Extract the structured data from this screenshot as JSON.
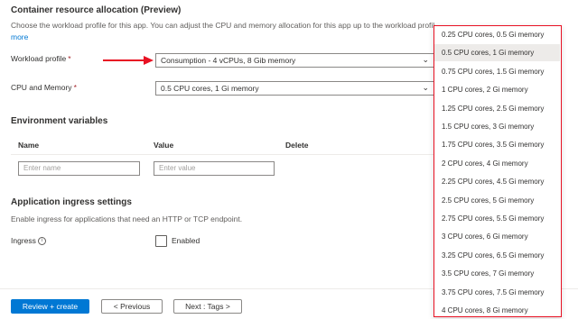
{
  "resource": {
    "title": "Container resource allocation (Preview)",
    "description": "Choose the workload profile for this app. You can adjust the CPU and memory allocation for this app up to the workload profile",
    "more_link": "more"
  },
  "workload_profile": {
    "label": "Workload profile",
    "required": "*",
    "value": "Consumption - 4 vCPUs, 8 Gib memory"
  },
  "cpu_memory": {
    "label": "CPU and Memory",
    "required": "*",
    "value": "0.5 CPU cores, 1 Gi memory"
  },
  "env": {
    "title": "Environment variables",
    "col_name": "Name",
    "col_value": "Value",
    "col_delete": "Delete",
    "name_placeholder": "Enter name",
    "value_placeholder": "Enter value"
  },
  "ingress": {
    "title": "Application ingress settings",
    "description": "Enable ingress for applications that need an HTTP or TCP endpoint.",
    "label": "Ingress",
    "info": "i",
    "enabled_label": "Enabled"
  },
  "footer": {
    "review_create": "Review + create",
    "previous": "< Previous",
    "next": "Next : Tags >"
  },
  "dropdown": {
    "selected_index": 1,
    "options": [
      "0.25 CPU cores, 0.5 Gi memory",
      "0.5 CPU cores, 1 Gi memory",
      "0.75 CPU cores, 1.5 Gi memory",
      "1 CPU cores, 2 Gi memory",
      "1.25 CPU cores, 2.5 Gi memory",
      "1.5 CPU cores, 3 Gi memory",
      "1.75 CPU cores, 3.5 Gi memory",
      "2 CPU cores, 4 Gi memory",
      "2.25 CPU cores, 4.5 Gi memory",
      "2.5 CPU cores, 5 Gi memory",
      "2.75 CPU cores, 5.5 Gi memory",
      "3 CPU cores, 6 Gi memory",
      "3.25 CPU cores, 6.5 Gi memory",
      "3.5 CPU cores, 7 Gi memory",
      "3.75 CPU cores, 7.5 Gi memory",
      "4 CPU cores, 8 Gi memory"
    ]
  },
  "colors": {
    "accent": "#0078d4",
    "highlight_border": "#e81123",
    "annotation_arrow": "#e81123"
  },
  "icons": {
    "chevron": "chevron-down-icon",
    "arrow": "red-arrow-icon"
  }
}
